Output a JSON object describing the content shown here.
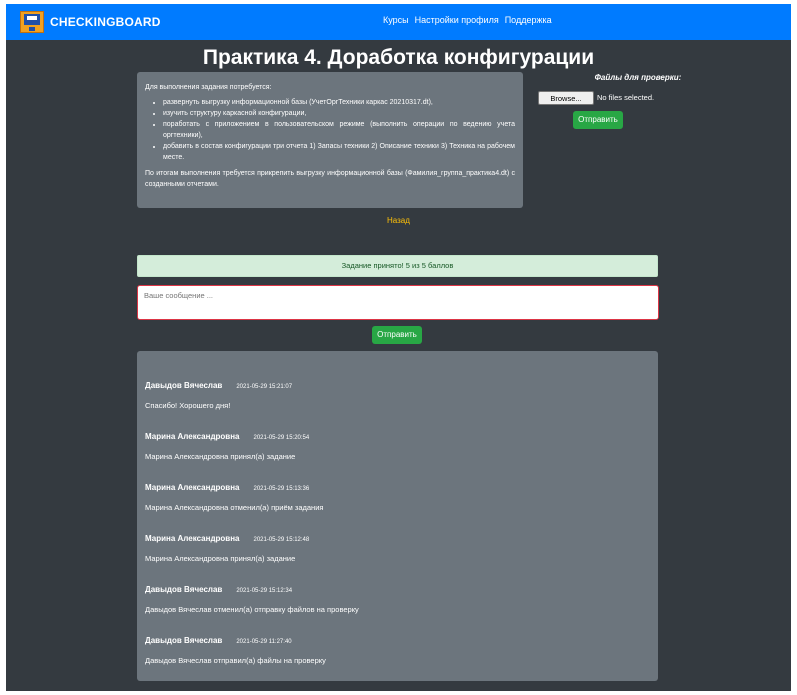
{
  "nav": {
    "brand": "CHECKINGBOARD",
    "links": [
      "Курсы",
      "Настройки профиля",
      "Поддержка"
    ]
  },
  "page": {
    "title": "Практика 4. Доработка конфигурации"
  },
  "task": {
    "intro": "Для выполнения задания потребуется:",
    "items": [
      "развернуть выгрузку информационной базы (УчетОргТехники каркас 20210317.dt),",
      "изучить структуру каркасной конфигурации,",
      "поработать с приложением в пользовательском режиме (выполнить операции по ведению учета оргтехники),",
      "добавить в состав конфигурации три отчета 1) Запасы техники 2) Описание техники 3) Техника на рабочем месте."
    ],
    "outro": "По итогам выполнения требуется прикрепить выгрузку информационной базы (Фамилия_группа_практика4.dt) с созданными отчетами."
  },
  "files": {
    "title": "Файлы для проверки:",
    "browse_label": "Browse...",
    "no_file_text": "No files selected.",
    "send_label": "Отправить"
  },
  "back_label": "Назад",
  "status": {
    "text": "Задание принято! 5 из 5 баллов"
  },
  "message": {
    "placeholder": "Ваше сообщение ...",
    "send_label": "Отправить"
  },
  "comments": [
    {
      "author": "Давыдов Вячеслав",
      "time": "2021-05-29 15:21:07",
      "text": "Спасибо! Хорошего дня!"
    },
    {
      "author": "Марина Александровна",
      "time": "2021-05-29 15:20:54",
      "text": "Марина Александровна принял(а) задание"
    },
    {
      "author": "Марина Александровна",
      "time": "2021-05-29 15:13:36",
      "text": "Марина Александровна отменил(а) приём задания"
    },
    {
      "author": "Марина Александровна",
      "time": "2021-05-29 15:12:48",
      "text": "Марина Александровна принял(а) задание"
    },
    {
      "author": "Давыдов Вячеслав",
      "time": "2021-05-29 15:12:34",
      "text": "Давыдов Вячеслав отменил(а) отправку файлов на проверку"
    },
    {
      "author": "Давыдов Вячеслав",
      "time": "2021-05-29 11:27:40",
      "text": "Давыдов Вячеслав отправил(а) файлы на проверку"
    }
  ],
  "colors": {
    "navbar": "#007bff",
    "background": "#343a40",
    "panel": "#6c757d",
    "success": "#28a745",
    "alert_bg": "#d4edda",
    "link": "#ffc107",
    "input_border": "#dc3545"
  }
}
